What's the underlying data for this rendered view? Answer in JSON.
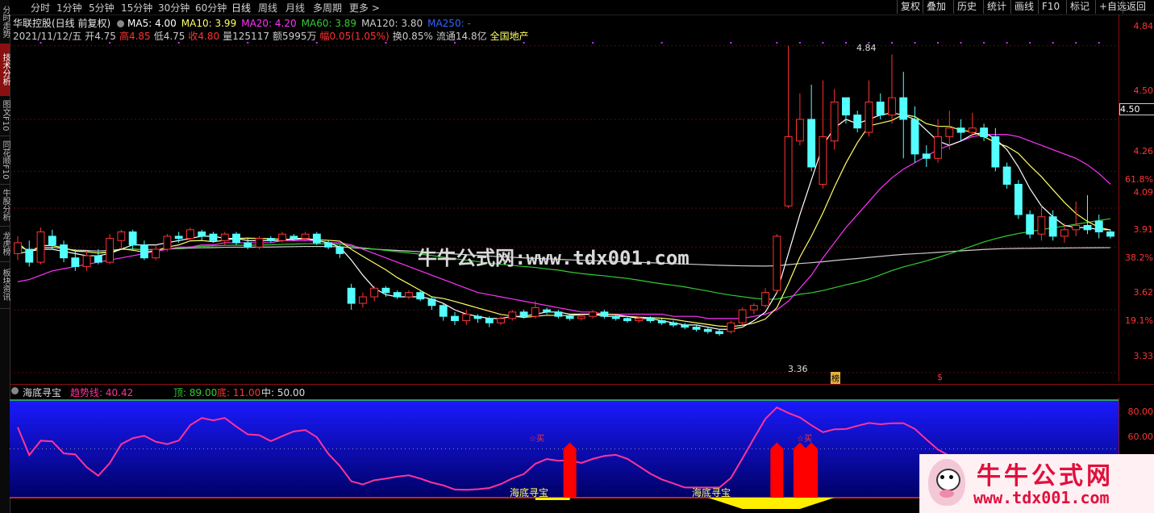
{
  "colors": {
    "up": "#ff3333",
    "down": "#54ffff",
    "ma5": "#ffffff",
    "ma10": "#ffff66",
    "ma20": "#ff33ff",
    "ma60": "#33cc33",
    "ma120": "#cccccc",
    "trend": "#ff3399",
    "band_top": "#1a1aff",
    "band_bottom": "#000066"
  },
  "left_tabs": [
    "分时走势",
    "技术分析",
    "图文F10",
    "同花顺F10",
    "牛股分析",
    "龙虎榜",
    "板块资讯"
  ],
  "toolbar": {
    "periods": [
      "分时",
      "1分钟",
      "5分钟",
      "15分钟",
      "30分钟",
      "60分钟",
      "日线",
      "周线",
      "月线",
      "多周期",
      "更多 >"
    ],
    "active_period": "日线",
    "right_buttons": [
      "复权",
      "叠加",
      "历史",
      "统计",
      "画线",
      "F10",
      "标记",
      "+自选",
      "返回"
    ]
  },
  "header": {
    "stock_name": "华联控股(日线 前复权)",
    "ma_labels": [
      {
        "text": "MA5: 4.00",
        "color": "#ffffff"
      },
      {
        "text": "MA10: 3.99",
        "color": "#ffff66"
      },
      {
        "text": "MA20: 4.20",
        "color": "#ff33ff"
      },
      {
        "text": "MA60: 3.89",
        "color": "#33cc33"
      },
      {
        "text": "MA120: 3.80",
        "color": "#cccccc"
      },
      {
        "text": "MA250: -",
        "color": "#3366ff"
      }
    ],
    "bar_info": [
      {
        "text": "2021/11/12/五",
        "color": "#cccccc"
      },
      {
        "text": "开4.75",
        "color": "#cccccc"
      },
      {
        "text": "高4.85",
        "color": "#ff3333"
      },
      {
        "text": "低4.75",
        "color": "#cccccc"
      },
      {
        "text": "收4.80",
        "color": "#ff3333"
      },
      {
        "text": "量125117",
        "color": "#cccccc"
      },
      {
        "text": "额5995万",
        "color": "#cccccc"
      },
      {
        "text": "幅0.05(1.05%)",
        "color": "#ff3333"
      },
      {
        "text": "换0.85%",
        "color": "#cccccc"
      },
      {
        "text": "流通14.8亿",
        "color": "#cccccc"
      },
      {
        "text": "全国地产",
        "color": "#ffff66"
      }
    ]
  },
  "price_axis": {
    "ticks": [
      "4.84",
      "4.50",
      "4.26",
      "4.09",
      "3.91",
      "3.62",
      "3.33"
    ],
    "current_price": "4.50",
    "fib_labels": [
      "61.8%",
      "38.2%",
      "19.1%"
    ]
  },
  "annotations": {
    "high_label": "4.84",
    "low_label": "3.36",
    "rank_badge": "榜",
    "dollar_badge": "$"
  },
  "watermark": "牛牛公式网:www.tdx001.com",
  "indicator": {
    "name": "海底寻宝",
    "trend_label": "趋势线: 40.42",
    "top_label": "顶: 89.00",
    "bottom_label": "底: 11.00",
    "mid_label": "中: 50.00",
    "axis_ticks": [
      "80.00",
      "60.00"
    ],
    "signal_texts": [
      "海底寻宝",
      "海底寻宝"
    ],
    "buy_marks": [
      "☆买",
      "☆买"
    ]
  },
  "logo": {
    "title": "牛牛公式网",
    "url": "www.tdx001.com"
  },
  "chart_data": {
    "type": "candlestick",
    "ylim": [
      3.3,
      4.88
    ],
    "candles": [
      [
        3.88,
        3.93,
        3.85,
        3.96
      ],
      [
        3.9,
        3.84,
        3.82,
        3.94
      ],
      [
        3.84,
        3.98,
        3.83,
        4.0
      ],
      [
        3.96,
        3.92,
        3.9,
        3.99
      ],
      [
        3.92,
        3.86,
        3.84,
        3.94
      ],
      [
        3.86,
        3.82,
        3.8,
        3.9
      ],
      [
        3.82,
        3.87,
        3.8,
        3.89
      ],
      [
        3.87,
        3.84,
        3.83,
        3.9
      ],
      [
        3.84,
        3.95,
        3.83,
        3.97
      ],
      [
        3.94,
        3.98,
        3.9,
        3.99
      ],
      [
        3.98,
        3.92,
        3.9,
        3.99
      ],
      [
        3.92,
        3.86,
        3.85,
        3.94
      ],
      [
        3.86,
        3.9,
        3.85,
        3.92
      ],
      [
        3.9,
        3.96,
        3.89,
        3.97
      ],
      [
        3.96,
        3.95,
        3.93,
        3.98
      ],
      [
        3.95,
        3.99,
        3.94,
        4.0
      ],
      [
        3.98,
        3.96,
        3.94,
        3.99
      ],
      [
        3.97,
        3.94,
        3.93,
        3.98
      ],
      [
        3.94,
        3.97,
        3.92,
        3.98
      ],
      [
        3.97,
        3.93,
        3.92,
        3.98
      ],
      [
        3.93,
        3.91,
        3.9,
        3.95
      ],
      [
        3.91,
        3.95,
        3.9,
        3.96
      ],
      [
        3.95,
        3.94,
        3.93,
        3.96
      ],
      [
        3.94,
        3.97,
        3.93,
        3.98
      ],
      [
        3.96,
        3.95,
        3.94,
        3.97
      ],
      [
        3.95,
        3.97,
        3.94,
        3.98
      ],
      [
        3.97,
        3.93,
        3.92,
        3.98
      ],
      [
        3.93,
        3.91,
        3.9,
        3.94
      ],
      [
        3.91,
        3.88,
        3.86,
        3.92
      ],
      [
        3.72,
        3.65,
        3.62,
        3.74
      ],
      [
        3.65,
        3.68,
        3.63,
        3.7
      ],
      [
        3.68,
        3.72,
        3.66,
        3.73
      ],
      [
        3.72,
        3.7,
        3.68,
        3.73
      ],
      [
        3.7,
        3.68,
        3.67,
        3.71
      ],
      [
        3.68,
        3.7,
        3.67,
        3.71
      ],
      [
        3.7,
        3.67,
        3.66,
        3.71
      ],
      [
        3.67,
        3.64,
        3.62,
        3.68
      ],
      [
        3.64,
        3.59,
        3.57,
        3.65
      ],
      [
        3.59,
        3.57,
        3.55,
        3.61
      ],
      [
        3.57,
        3.6,
        3.55,
        3.62
      ],
      [
        3.59,
        3.58,
        3.56,
        3.6
      ],
      [
        3.58,
        3.56,
        3.54,
        3.59
      ],
      [
        3.56,
        3.58,
        3.55,
        3.59
      ],
      [
        3.58,
        3.61,
        3.57,
        3.62
      ],
      [
        3.61,
        3.59,
        3.58,
        3.62
      ],
      [
        3.59,
        3.63,
        3.58,
        3.66
      ],
      [
        3.62,
        3.61,
        3.6,
        3.63
      ],
      [
        3.61,
        3.59,
        3.58,
        3.62
      ],
      [
        3.59,
        3.58,
        3.57,
        3.6
      ],
      [
        3.58,
        3.59,
        3.57,
        3.6
      ],
      [
        3.59,
        3.61,
        3.58,
        3.62
      ],
      [
        3.61,
        3.59,
        3.58,
        3.62
      ],
      [
        3.59,
        3.58,
        3.57,
        3.6
      ],
      [
        3.58,
        3.57,
        3.56,
        3.59
      ],
      [
        3.57,
        3.58,
        3.56,
        3.59
      ],
      [
        3.58,
        3.57,
        3.56,
        3.59
      ],
      [
        3.57,
        3.56,
        3.55,
        3.58
      ],
      [
        3.56,
        3.55,
        3.54,
        3.57
      ],
      [
        3.55,
        3.54,
        3.53,
        3.56
      ],
      [
        3.54,
        3.53,
        3.52,
        3.55
      ],
      [
        3.53,
        3.52,
        3.51,
        3.54
      ],
      [
        3.52,
        3.51,
        3.5,
        3.53
      ],
      [
        3.52,
        3.56,
        3.51,
        3.57
      ],
      [
        3.56,
        3.62,
        3.55,
        3.63
      ],
      [
        3.62,
        3.64,
        3.6,
        3.65
      ],
      [
        3.64,
        3.7,
        3.63,
        3.72
      ],
      [
        3.71,
        3.96,
        3.7,
        3.97
      ],
      [
        4.1,
        4.42,
        4.09,
        4.84
      ],
      [
        4.4,
        4.5,
        4.38,
        4.62
      ],
      [
        4.5,
        4.28,
        4.26,
        4.66
      ],
      [
        4.2,
        4.42,
        4.18,
        4.68
      ],
      [
        4.4,
        4.58,
        4.36,
        4.64
      ],
      [
        4.6,
        4.52,
        4.48,
        4.6
      ],
      [
        4.52,
        4.46,
        4.44,
        4.54
      ],
      [
        4.44,
        4.58,
        4.42,
        4.68
      ],
      [
        4.58,
        4.52,
        4.5,
        4.62
      ],
      [
        4.52,
        4.6,
        4.48,
        4.8
      ],
      [
        4.6,
        4.5,
        4.32,
        4.72
      ],
      [
        4.5,
        4.34,
        4.3,
        4.56
      ],
      [
        4.34,
        4.32,
        4.28,
        4.38
      ],
      [
        4.32,
        4.42,
        4.3,
        4.5
      ],
      [
        4.42,
        4.46,
        4.36,
        4.54
      ],
      [
        4.46,
        4.44,
        4.4,
        4.5
      ],
      [
        4.44,
        4.46,
        4.42,
        4.53
      ],
      [
        4.46,
        4.42,
        4.4,
        4.48
      ],
      [
        4.42,
        4.28,
        4.26,
        4.46
      ],
      [
        4.28,
        4.2,
        4.18,
        4.3
      ],
      [
        4.2,
        4.06,
        4.04,
        4.22
      ],
      [
        4.06,
        3.97,
        3.95,
        4.08
      ],
      [
        3.97,
        4.05,
        3.94,
        4.1
      ],
      [
        4.05,
        3.96,
        3.94,
        4.08
      ],
      [
        3.96,
        3.99,
        3.93,
        4.02
      ],
      [
        3.99,
        4.01,
        3.96,
        4.12
      ],
      [
        4.01,
        3.99,
        3.97,
        4.15
      ],
      [
        4.03,
        3.98,
        3.95,
        4.06
      ],
      [
        3.98,
        3.96,
        3.95,
        3.99
      ]
    ],
    "ma5": [
      3.88,
      3.89,
      3.9,
      3.9,
      3.89,
      3.88,
      3.87,
      3.87,
      3.88,
      3.9,
      3.92,
      3.92,
      3.92,
      3.93,
      3.94,
      3.95,
      3.96,
      3.96,
      3.95,
      3.95,
      3.94,
      3.94,
      3.94,
      3.94,
      3.95,
      3.95,
      3.94,
      3.93,
      3.91,
      3.85,
      3.78,
      3.72,
      3.69,
      3.68,
      3.68,
      3.68,
      3.67,
      3.65,
      3.62,
      3.6,
      3.59,
      3.58,
      3.58,
      3.59,
      3.59,
      3.6,
      3.61,
      3.61,
      3.6,
      3.6,
      3.6,
      3.59,
      3.59,
      3.59,
      3.58,
      3.58,
      3.57,
      3.56,
      3.55,
      3.55,
      3.54,
      3.53,
      3.53,
      3.54,
      3.57,
      3.61,
      3.7,
      3.88,
      4.06,
      4.22,
      4.38,
      4.46,
      4.5,
      4.48,
      4.5,
      4.52,
      4.53,
      4.52,
      4.5,
      4.45,
      4.4,
      4.38,
      4.4,
      4.43,
      4.44,
      4.41,
      4.36,
      4.28,
      4.18,
      4.1,
      4.05,
      4.01,
      4.0,
      4.0,
      3.99,
      3.99
    ],
    "ma20": [
      3.75,
      3.76,
      3.78,
      3.8,
      3.81,
      3.82,
      3.83,
      3.84,
      3.85,
      3.86,
      3.87,
      3.88,
      3.89,
      3.9,
      3.91,
      3.91,
      3.92,
      3.92,
      3.93,
      3.93,
      3.93,
      3.93,
      3.93,
      3.94,
      3.94,
      3.94,
      3.94,
      3.93,
      3.93,
      3.92,
      3.9,
      3.88,
      3.86,
      3.84,
      3.82,
      3.8,
      3.78,
      3.76,
      3.74,
      3.72,
      3.7,
      3.69,
      3.68,
      3.67,
      3.66,
      3.65,
      3.64,
      3.63,
      3.62,
      3.61,
      3.61,
      3.6,
      3.6,
      3.6,
      3.6,
      3.6,
      3.6,
      3.59,
      3.59,
      3.59,
      3.58,
      3.58,
      3.58,
      3.58,
      3.59,
      3.6,
      3.62,
      3.66,
      3.72,
      3.78,
      3.86,
      3.93,
      4.0,
      4.06,
      4.12,
      4.18,
      4.23,
      4.27,
      4.3,
      4.33,
      4.36,
      4.38,
      4.4,
      4.42,
      4.43,
      4.43,
      4.43,
      4.42,
      4.4,
      4.38,
      4.36,
      4.34,
      4.32,
      4.29,
      4.25,
      4.2
    ]
  }
}
